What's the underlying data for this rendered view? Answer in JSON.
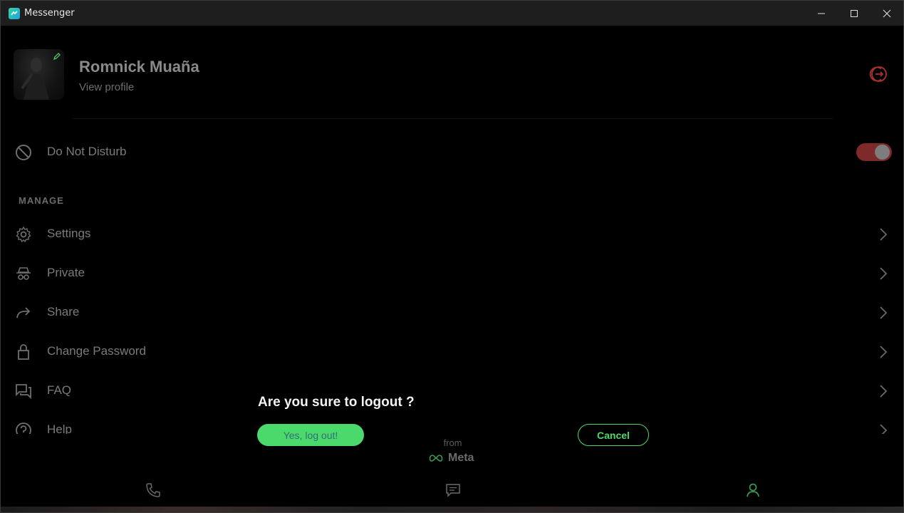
{
  "window": {
    "title": "Messenger",
    "controls": [
      "minimize-icon",
      "maximize-icon",
      "close-icon"
    ]
  },
  "profile": {
    "name": "Romnick Muaña",
    "view_profile": "View profile"
  },
  "do_not_disturb": {
    "label": "Do Not Disturb",
    "enabled": true
  },
  "manage": {
    "section_label": "MANAGE",
    "items": [
      {
        "label": "Settings",
        "icon": "gear-icon"
      },
      {
        "label": "Private",
        "icon": "incognito-icon"
      },
      {
        "label": "Share",
        "icon": "share-icon"
      },
      {
        "label": "Change Password",
        "icon": "lock-icon"
      },
      {
        "label": "FAQ",
        "icon": "chat-bubbles-icon"
      },
      {
        "label": "Help",
        "icon": "help-icon"
      }
    ]
  },
  "dialog": {
    "title": "Are you sure to logout ?",
    "confirm_label": "Yes, log out!",
    "cancel_label": "Cancel"
  },
  "footer": {
    "from": "from",
    "brand": "Meta"
  },
  "bottom_nav": [
    "phone-icon",
    "chat-icon",
    "profile-icon"
  ],
  "colors": {
    "accent_green": "#4cd96b",
    "toggle_on": "#7e2a2a",
    "logout_red": "#c0392b"
  }
}
